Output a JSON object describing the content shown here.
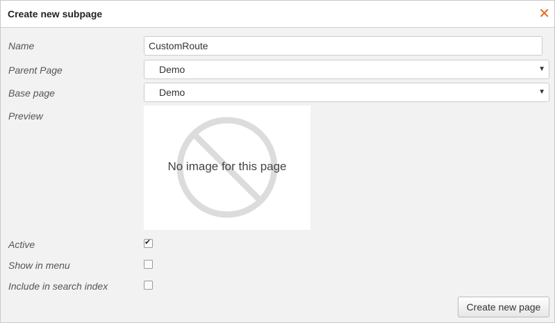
{
  "dialog": {
    "title": "Create new subpage",
    "close_icon": "close-icon"
  },
  "form": {
    "name_label": "Name",
    "name_value": "CustomRoute",
    "parent_label": "Parent Page",
    "parent_value": "Demo",
    "base_label": "Base page",
    "base_value": "Demo",
    "preview_label": "Preview",
    "preview_text": "No image for this page",
    "active_label": "Active",
    "active_checked": true,
    "menu_label": "Show in menu",
    "menu_checked": false,
    "search_label": "Include in search index",
    "search_checked": false
  },
  "footer": {
    "create_label": "Create new page"
  },
  "colors": {
    "accent": "#e8661e"
  }
}
